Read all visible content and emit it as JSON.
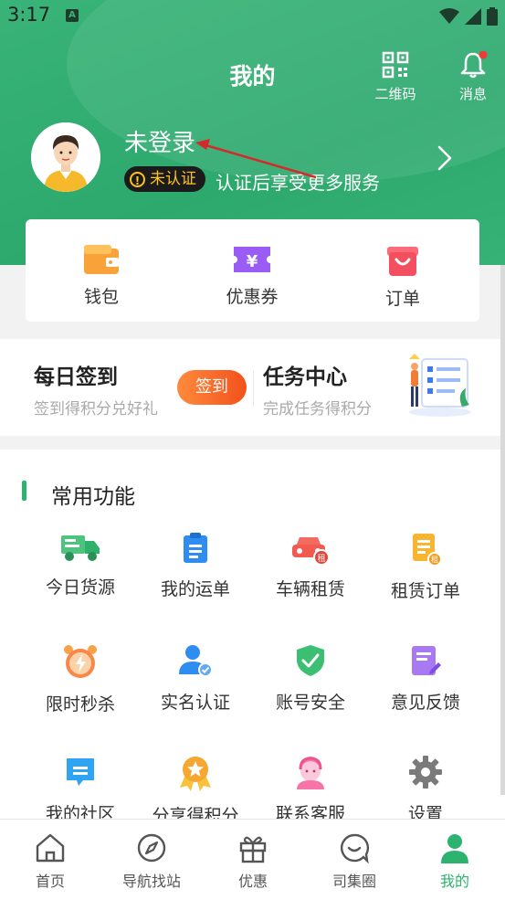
{
  "status_bar": {
    "time": "3:17",
    "notification_icon": "a-notification-icon",
    "icons": [
      "wifi-icon",
      "signal-icon",
      "battery-icon"
    ]
  },
  "header": {
    "title": "我的",
    "qr_label": "二维码",
    "message_label": "消息",
    "user_name": "未登录",
    "badge_text": "未认证",
    "verify_hint": "认证后享受更多服务"
  },
  "quick_card": [
    {
      "label": "钱包",
      "icon": "wallet-icon"
    },
    {
      "label": "优惠券",
      "icon": "coupon-icon"
    },
    {
      "label": "订单",
      "icon": "order-bag-icon"
    }
  ],
  "tasks": {
    "checkin_title": "每日签到",
    "checkin_sub": "签到得积分兑好礼",
    "checkin_button": "签到",
    "task_title": "任务中心",
    "task_sub": "完成任务得积分"
  },
  "functions": {
    "section_title": "常用功能",
    "items": [
      {
        "label": "今日货源",
        "icon": "truck-icon"
      },
      {
        "label": "我的运单",
        "icon": "waybill-icon"
      },
      {
        "label": "车辆租赁",
        "icon": "car-rental-icon"
      },
      {
        "label": "租赁订单",
        "icon": "rental-order-icon"
      },
      {
        "label": "限时秒杀",
        "icon": "alarm-clock-icon"
      },
      {
        "label": "实名认证",
        "icon": "user-verified-icon"
      },
      {
        "label": "账号安全",
        "icon": "shield-check-icon"
      },
      {
        "label": "意见反馈",
        "icon": "feedback-edit-icon"
      },
      {
        "label": "我的社区",
        "icon": "chat-bubble-icon"
      },
      {
        "label": "分享得积分",
        "icon": "medal-star-icon"
      },
      {
        "label": "联系客服",
        "icon": "customer-service-icon"
      },
      {
        "label": "设置",
        "icon": "gear-icon"
      }
    ]
  },
  "bottom_nav": [
    {
      "label": "首页",
      "icon": "home-icon"
    },
    {
      "label": "导航找站",
      "icon": "compass-icon"
    },
    {
      "label": "优惠",
      "icon": "gift-icon"
    },
    {
      "label": "司集圈",
      "icon": "chat-circle-icon"
    },
    {
      "label": "我的",
      "icon": "person-icon",
      "active": true
    }
  ],
  "colors": {
    "primary_green": "#2cb36d",
    "badge_yellow": "#ffc21b",
    "signin_orange": "#f2511b"
  }
}
